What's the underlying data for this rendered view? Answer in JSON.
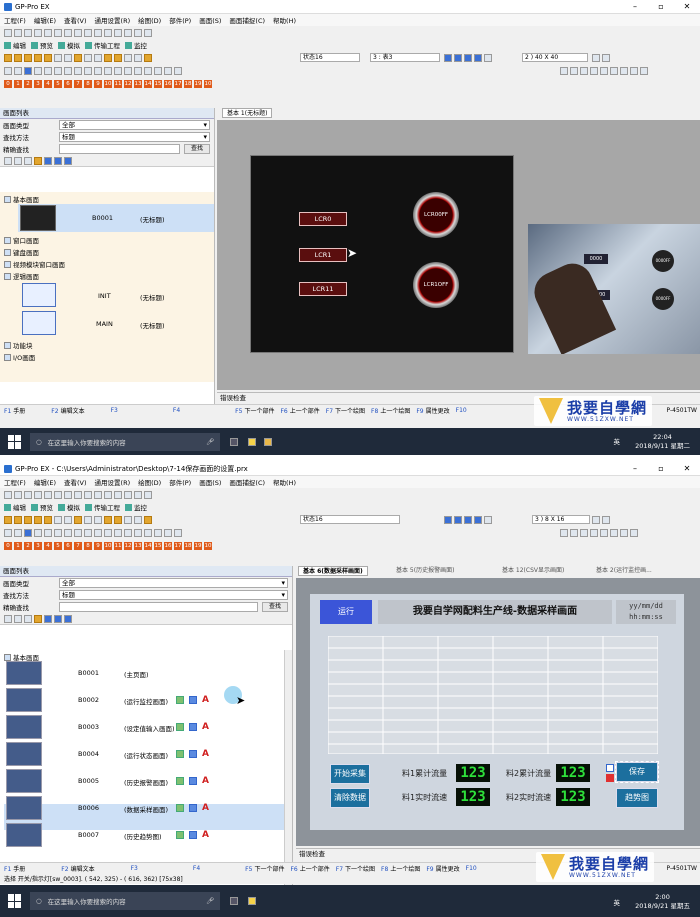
{
  "app": {
    "short_title": "GP-Pro EX",
    "full_title": "GP-Pro EX - C:\\Users\\Administrator\\Desktop\\7-14保存画面的设置.prx"
  },
  "menu": [
    "工程(F)",
    "编辑(E)",
    "查看(V)",
    "通用设置(R)",
    "绘图(D)",
    "部件(P)",
    "画面(S)",
    "画面捕捉(C)",
    "帮助(H)"
  ],
  "mode_tabs": [
    "编辑",
    "预览",
    "模拟",
    "传输工程",
    "监控"
  ],
  "toolbar": {
    "state_select": "状态16",
    "size_select_1": "3 : 表3",
    "size_readout_1": "2 ) 40 X 40",
    "size_readout_2": "3 ) 8 X 16"
  },
  "numbered_buttons": [
    "0",
    "1",
    "2",
    "3",
    "4",
    "5",
    "6",
    "7",
    "8",
    "9",
    "10",
    "11",
    "12",
    "13",
    "14",
    "15",
    "16",
    "17",
    "18",
    "19",
    "10"
  ],
  "left_panel": {
    "title": "画面列表",
    "screen_type_label": "画面类型",
    "screen_type_value": "全部",
    "search_method_label": "查找方法",
    "search_method_value": "标题",
    "exact_search_label": "精确查找",
    "search_button": "查找",
    "tree": {
      "base": "基本画面",
      "window": "窗口画面",
      "keypad": "键盘画面",
      "video": "视频模块窗口画面",
      "logic": "逻辑画面",
      "function": "功能块",
      "io": "I/O画面"
    }
  },
  "screens_1": [
    {
      "id": "B0001",
      "title": "(无标题)"
    },
    {
      "id": "INIT",
      "title": "(无标题)"
    },
    {
      "id": "MAIN",
      "title": "(无标题)"
    }
  ],
  "screens_2": [
    {
      "id": "B0001",
      "title": "(主页面)"
    },
    {
      "id": "B0002",
      "title": "(运行监控画面)"
    },
    {
      "id": "B0003",
      "title": "(设定值输入画面)"
    },
    {
      "id": "B0004",
      "title": "(运行状态画面)"
    },
    {
      "id": "B0005",
      "title": "(历史报警画面)"
    },
    {
      "id": "B0006",
      "title": "(数据采样画面)"
    },
    {
      "id": "B0007",
      "title": "(历史趋势图)"
    }
  ],
  "doc_tab_1": "基本 1(无标题)",
  "doc_tabs_2": [
    "基本 6(数据采样画面)",
    "基本 5(历史报警画面)",
    "基本 12(CSV显示画面)",
    "基本 2(运行监控画..."
  ],
  "hmi1": {
    "buttons": [
      "LCR0",
      "LCR1",
      "LCR11"
    ],
    "lamps": [
      "LCR00FF",
      "LCR1OFF"
    ],
    "photo_labels": [
      "0000",
      "0000",
      "0000FF",
      "0000FF"
    ]
  },
  "hmi2": {
    "run_button": "运行",
    "title": "我要自学网配料生产线-数据采样画面",
    "date_format": "yy/mm/dd",
    "time_format": "hh:mm:ss",
    "start_button": "开始采集",
    "clear_button": "清除数据",
    "save_button": "保存",
    "trend_button": "趋势图",
    "labels": [
      "料1累计流量",
      "料2累计流量",
      "料1实时流速",
      "料2实时流速"
    ],
    "values": [
      "123",
      "123",
      "123",
      "123"
    ]
  },
  "error_panel": "错误检查",
  "fkeys_1": [
    [
      "F1",
      "手册"
    ],
    [
      "F2",
      "编辑文本"
    ],
    [
      "F3",
      ""
    ],
    [
      "F4",
      ""
    ],
    [
      "F5",
      "下一个部件"
    ],
    [
      "F6",
      "上一个部件"
    ],
    [
      "F7",
      "下一个绘图"
    ],
    [
      "F8",
      "上一个绘图"
    ],
    [
      "F9",
      "属性更改"
    ],
    [
      "F10",
      ""
    ]
  ],
  "fkeys_2": [
    [
      "F1",
      "手册"
    ],
    [
      "F2",
      "编辑文本"
    ],
    [
      "F3",
      ""
    ],
    [
      "F4",
      ""
    ],
    [
      "F5",
      "下一个部件"
    ],
    [
      "F6",
      "上一个部件"
    ],
    [
      "F7",
      "下一个绘图"
    ],
    [
      "F8",
      "上一个绘图"
    ],
    [
      "F9",
      "属性更改"
    ],
    [
      "F10",
      ""
    ]
  ],
  "model_1": "P-4501TW",
  "model_2": "P-4501TW",
  "status_line_2": "选择  开关/指示灯[sw_0003]. ( 542, 325) - ( 616, 362) [75x38]",
  "watermark": {
    "brand": "我要自學網",
    "url": "WWW.51ZXW.NET"
  },
  "taskbar": {
    "search_placeholder": "在这里输入你要搜索的内容",
    "ime": "英",
    "time_1": "22:04",
    "date_1": "2018/9/11 星期二",
    "time_2": "2:00",
    "date_2": "2018/9/21 星期五"
  }
}
